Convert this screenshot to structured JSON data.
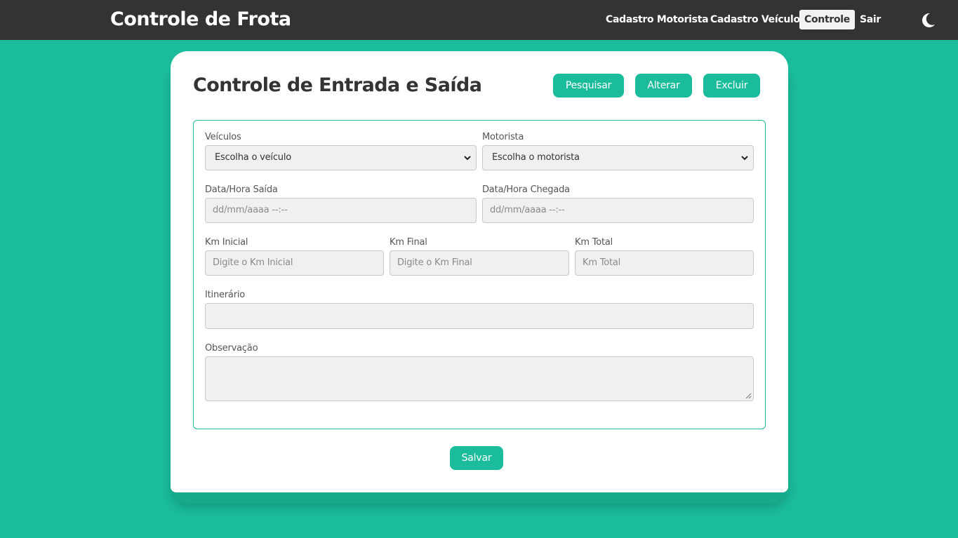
{
  "app": {
    "title": "Controle de Frota",
    "nav": [
      {
        "label": "Cadastro Motorista"
      },
      {
        "label": "Cadastro Veículo"
      },
      {
        "label": "Controle"
      },
      {
        "label": "Sair"
      }
    ],
    "active_nav": "Controle",
    "theme_toggle_icon": "moon-icon"
  },
  "page": {
    "title": "Controle de Entrada e Saída",
    "actions": {
      "search_label": "Pesquisar",
      "edit_label": "Alterar",
      "delete_label": "Excluir"
    },
    "form": {
      "vehicle": {
        "label": "Veículos",
        "value": "Escolha o veículo"
      },
      "driver": {
        "label": "Motorista",
        "value": "Escolha o motorista"
      },
      "departure": {
        "label": "Data/Hora Saída",
        "placeholder": "dd/mm/aaaa --:--"
      },
      "arrival": {
        "label": "Data/Hora Chegada",
        "placeholder": "dd/mm/aaaa --:--"
      },
      "km_start": {
        "label": "Km Inicial",
        "placeholder": "Digite o Km Inicial"
      },
      "km_end": {
        "label": "Km Final",
        "placeholder": "Digite o Km Final"
      },
      "km_total": {
        "label": "Km Total",
        "placeholder": "Km Total"
      },
      "itinerary": {
        "label": "Itinerário",
        "value": ""
      },
      "notes": {
        "label": "Observação",
        "value": ""
      }
    },
    "save_label": "Salvar"
  },
  "colors": {
    "accent": "#1abc9c",
    "navbar": "#333333",
    "field_bg": "#f0f0f0"
  }
}
